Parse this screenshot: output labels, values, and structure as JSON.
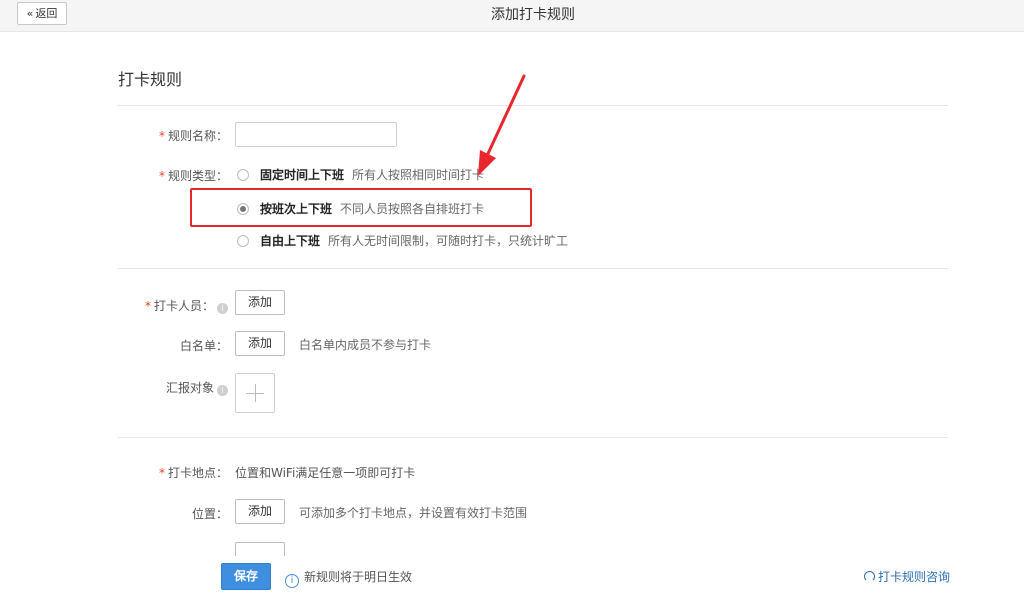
{
  "header": {
    "back_label": "返回",
    "title": "添加打卡规则"
  },
  "section": {
    "title": "打卡规则"
  },
  "rule_name": {
    "label": "规则名称：",
    "value": "",
    "placeholder": ""
  },
  "rule_type": {
    "label": "规则类型：",
    "options": [
      {
        "label": "固定时间上下班",
        "desc": "所有人按照相同时间打卡",
        "checked": false
      },
      {
        "label": "按班次上下班",
        "desc": "不同人员按照各自排班打卡",
        "checked": true
      },
      {
        "label": "自由上下班",
        "desc": "所有人无时间限制，可随时打卡，只统计旷工",
        "checked": false
      }
    ]
  },
  "members": {
    "label": "打卡人员：",
    "add_label": "添加"
  },
  "whitelist": {
    "label": "白名单：",
    "add_label": "添加",
    "hint": "白名单内成员不参与打卡"
  },
  "report_to": {
    "label": "汇报对象"
  },
  "location": {
    "label": "打卡地点：",
    "hint": "位置和WiFi满足任意一项即可打卡",
    "position_label": "位置：",
    "add_label": "添加",
    "position_hint": "可添加多个打卡地点，并设置有效打卡范围"
  },
  "footer": {
    "save_label": "保存",
    "notice": "新规则将于明日生效",
    "consult_label": "打卡规则咨询"
  },
  "colors": {
    "accent": "#3f8ee0",
    "required": "#e0462f",
    "highlight": "#e8262b",
    "link": "#2b6cb3"
  }
}
